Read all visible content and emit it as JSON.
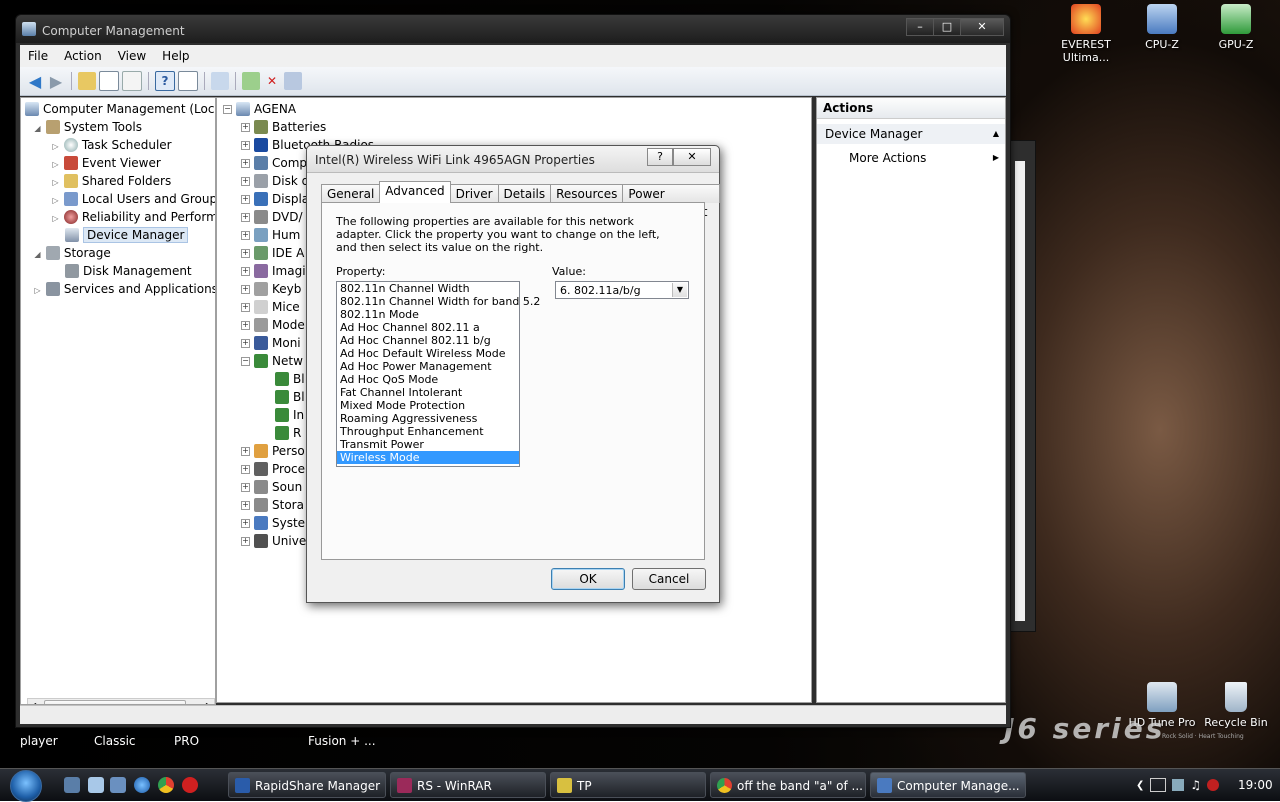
{
  "desktop": {
    "icons": [
      {
        "label": "EVEREST Ultima...",
        "color": "#e04020"
      },
      {
        "label": "CPU-Z",
        "color": "#4a7ac0"
      },
      {
        "label": "GPU-Z",
        "color": "#2f9a3a"
      },
      {
        "label": "HD Tune Pro",
        "color": "#7fa0c0"
      },
      {
        "label": "Recycle Bin",
        "color": "#9fb4c8"
      }
    ],
    "bottom_labels": [
      "player",
      "Classic",
      "PRO",
      "Fusion + ..."
    ],
    "brand": "J6 series",
    "brand_sub": "Rock Solid · Heart Touching"
  },
  "main_window": {
    "title": "Computer Management",
    "menu": [
      "File",
      "Action",
      "View",
      "Help"
    ],
    "tree": [
      {
        "label": "Computer Management (Local",
        "indent": 0
      },
      {
        "label": "System Tools",
        "indent": 1
      },
      {
        "label": "Task Scheduler",
        "indent": 2
      },
      {
        "label": "Event Viewer",
        "indent": 2
      },
      {
        "label": "Shared Folders",
        "indent": 2
      },
      {
        "label": "Local Users and Groups",
        "indent": 2
      },
      {
        "label": "Reliability and Performa",
        "indent": 2
      },
      {
        "label": "Device Manager",
        "indent": 2,
        "selected": true
      },
      {
        "label": "Storage",
        "indent": 1
      },
      {
        "label": "Disk Management",
        "indent": 2
      },
      {
        "label": "Services and Applications",
        "indent": 1
      }
    ],
    "device_tree": {
      "root": "AGENA",
      "items": [
        "Batteries",
        "Bluetooth Radios",
        "Comp",
        "Disk d",
        "Displa",
        "DVD/",
        "Hum",
        "IDE A",
        "Imagi",
        "Keyb",
        "Mice",
        "Mode",
        "Moni",
        "Netw",
        "Bl",
        "Bl",
        "In",
        "R",
        "Perso",
        "Proce",
        "Soun",
        "Stora",
        "Syste",
        "Unive"
      ]
    },
    "actions": {
      "header": "Actions",
      "section": "Device Manager",
      "item": "More Actions"
    }
  },
  "dialog": {
    "title": "Intel(R) Wireless WiFi Link 4965AGN Properties",
    "help_btn": "?",
    "close_btn": "✕",
    "tabs": [
      "General",
      "Advanced",
      "Driver",
      "Details",
      "Resources",
      "Power Management"
    ],
    "active_tab": "Advanced",
    "description": "The following properties are available for this network adapter. Click the property you want to change on the left, and then select its value on the right.",
    "property_label": "Property:",
    "value_label": "Value:",
    "properties": [
      "802.11n Channel Width",
      "802.11n Channel Width for band 5.2",
      "802.11n Mode",
      "Ad Hoc Channel 802.11 a",
      "Ad Hoc Channel 802.11 b/g",
      "Ad Hoc Default Wireless Mode",
      "Ad Hoc Power Management",
      "Ad Hoc QoS Mode",
      "Fat Channel Intolerant",
      "Mixed Mode Protection",
      "Roaming Aggressiveness",
      "Throughput Enhancement",
      "Transmit Power",
      "Wireless Mode"
    ],
    "selected_property": "Wireless Mode",
    "value": "6. 802.11a/b/g",
    "ok": "OK",
    "cancel": "Cancel"
  },
  "taskbar": {
    "tasks": [
      {
        "label": "RapidShare Manager",
        "color": "#2a5caa"
      },
      {
        "label": "RS - WinRAR",
        "color": "#9b2a5a"
      },
      {
        "label": "TP",
        "color": "#d8c040"
      },
      {
        "label": "off the band \"a\" of ...",
        "color": "#e0a020"
      },
      {
        "label": "Computer Manage...",
        "color": "#4a7ac0"
      }
    ],
    "clock": "19:00"
  },
  "colors": {
    "selection": "#3399ff",
    "tree_selection": "#dce8f5"
  }
}
